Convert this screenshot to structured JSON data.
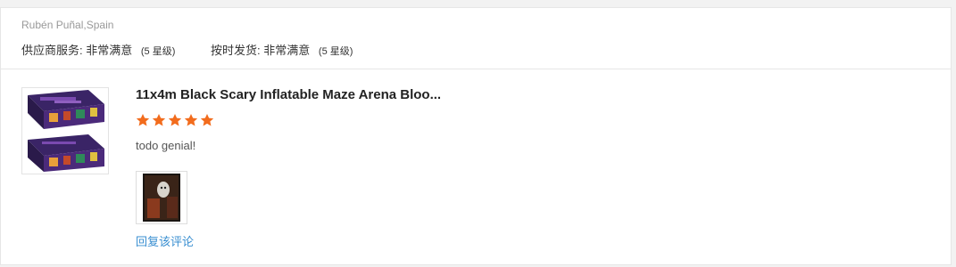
{
  "review": {
    "reviewer": "Rubén Puñal,Spain",
    "ratings": [
      {
        "label": "供应商服务:",
        "value": "非常满意",
        "stars_text": "(5 星级)"
      },
      {
        "label": "按时发货:",
        "value": "非常满意",
        "stars_text": "(5 星级)"
      }
    ],
    "product_title": "11x4m Black Scary Inflatable Maze Arena Bloo...",
    "star_rating": 5,
    "comment": "todo genial!",
    "reply_link": "回复该评论",
    "star_color": "#f26c1d",
    "link_color": "#3a8fd1"
  }
}
